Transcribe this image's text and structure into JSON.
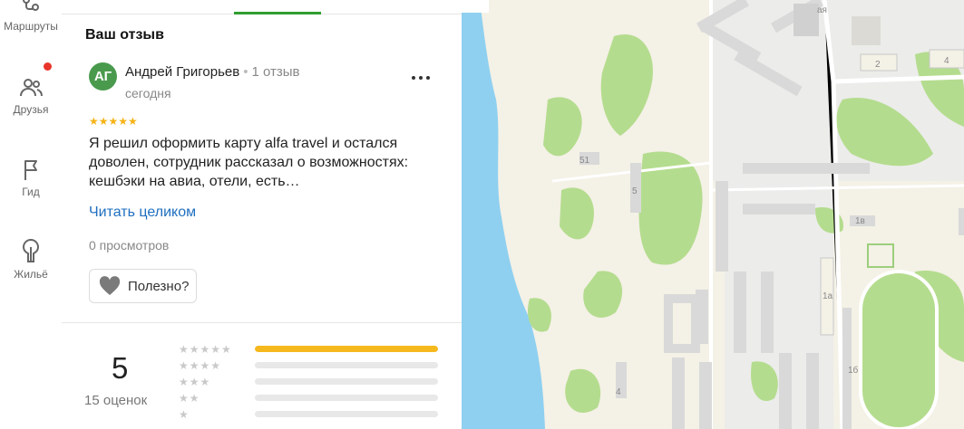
{
  "rail": {
    "items": [
      {
        "label": "Маршруты",
        "icon": "route-icon"
      },
      {
        "label": "Друзья",
        "icon": "friends-icon",
        "notification": true
      },
      {
        "label": "Гид",
        "icon": "flag-icon"
      },
      {
        "label": "Жильё",
        "icon": "housing-icon"
      }
    ]
  },
  "review_section": {
    "title": "Ваш отзыв",
    "avatar_initials": "АГ",
    "author": "Андрей Григорьев",
    "review_count": "1 отзыв",
    "date": "сегодня",
    "rating_stars": "★★★★★",
    "text": "Я решил оформить карту alfa travel и остался доволен, сотрудник рассказал о возможностях: кешбэки на авиа, отели, есть…",
    "read_more": "Читать целиком",
    "views": "0 просмотров",
    "useful_label": "Полезно?"
  },
  "summary": {
    "score": "5",
    "count_label": "15 оценок",
    "distribution": [
      {
        "stars": "★★★★★",
        "fraction": 1.0
      },
      {
        "stars": "★★★★",
        "fraction": 0
      },
      {
        "stars": "★★★",
        "fraction": 0
      },
      {
        "stars": "★★",
        "fraction": 0
      },
      {
        "stars": "★",
        "fraction": 0
      }
    ]
  },
  "map": {
    "labels": [
      "51",
      "5",
      "2",
      "4",
      "1в",
      "1а",
      "1б",
      "4",
      "ая"
    ]
  },
  "colors": {
    "accent_green": "#2f9e2f",
    "star_yellow": "#f5b316",
    "link_blue": "#1f6fbf",
    "notification_red": "#e8352a",
    "water": "#8fd0f0",
    "park": "#b4dc8e"
  }
}
